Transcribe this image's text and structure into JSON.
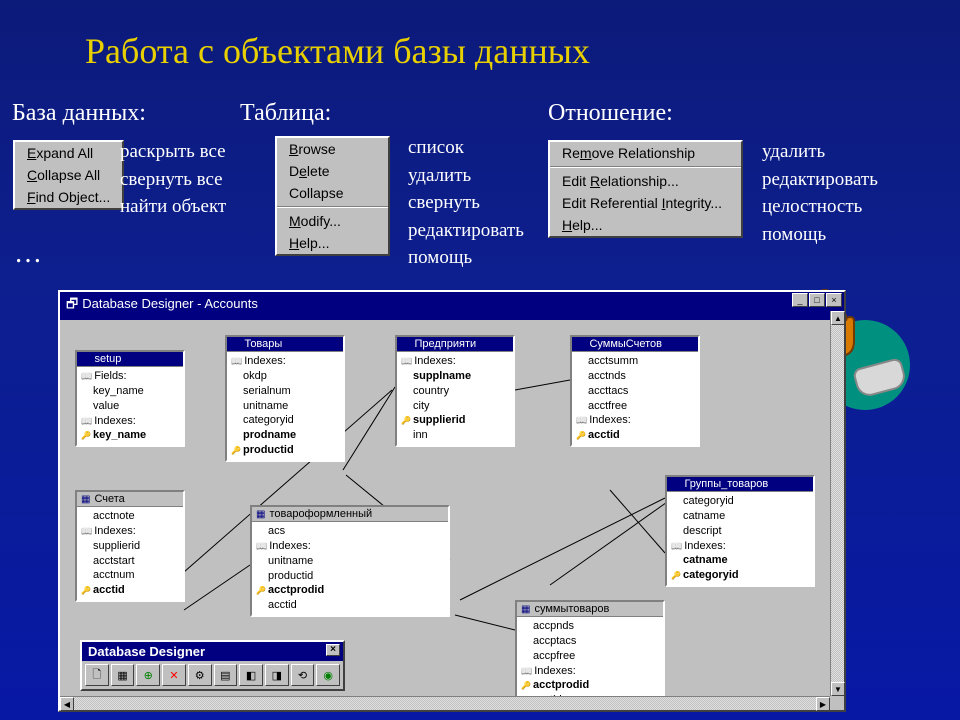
{
  "title": "Работа с объектами базы данных",
  "sections": {
    "db": "База данных:",
    "table": "Таблица:",
    "rel": "Отношение:"
  },
  "ellipsis": "…",
  "menu_db": {
    "expand": "Expand All",
    "collapse": "Collapse All",
    "find": "Find Object..."
  },
  "ru_db": {
    "expand": "раскрыть все",
    "collapse": "свернуть все",
    "find": "найти объект"
  },
  "menu_table": {
    "browse": "Browse",
    "delete": "Delete",
    "collapse": "Collapse",
    "modify": "Modify...",
    "help": "Help..."
  },
  "ru_table": {
    "browse": "список",
    "delete": "удалить",
    "collapse": "свернуть",
    "modify": "редактировать",
    "help": "помощь"
  },
  "menu_rel": {
    "remove": "Remove Relationship",
    "edit": "Edit Relationship...",
    "integrity": "Edit Referential Integrity...",
    "help": "Help..."
  },
  "ru_rel": {
    "remove": "удалить",
    "edit": "редактировать",
    "integrity": "целостность",
    "help": "помощь"
  },
  "designer_title": "Database Designer - Accounts",
  "toolbar_title": "Database Designer",
  "tables": {
    "setup": {
      "title": "setup",
      "fields": "Fields:",
      "f1": "key_name",
      "f2": "value",
      "idx": "Indexes:",
      "k": "key_name"
    },
    "tovary": {
      "title": "Товары",
      "idx": "Indexes:",
      "f1": "okdp",
      "f2": "serialnum",
      "f3": "unitname",
      "f4": "categoryid",
      "f5": "prodname",
      "k": "productid"
    },
    "pred": {
      "title": "Предприяти",
      "idx": "Indexes:",
      "f1": "supplname",
      "f2": "country",
      "f3": "city",
      "k": "supplierid",
      "f4": "inn"
    },
    "summy": {
      "title": "СуммыСчетов",
      "f1": "acctsumm",
      "f2": "acctnds",
      "f3": "accttacs",
      "f4": "acctfree",
      "idx": "Indexes:",
      "k": "acctid"
    },
    "scheta": {
      "title": "Счета",
      "f1": "acctnote",
      "idx": "Indexes:",
      "f2": "supplierid",
      "f3": "acctstart",
      "f4": "acctnum",
      "k": "acctid"
    },
    "tovof": {
      "title": "товароформленный",
      "f1": "acs",
      "idx": "Indexes:",
      "f2": "unitname",
      "f3": "productid",
      "k": "acctprodid",
      "f4": "acctid"
    },
    "gruppy": {
      "title": "Группы_товаров",
      "f1": "categoryid",
      "f2": "catname",
      "f3": "descript",
      "idx": "Indexes:",
      "f4": "catname",
      "k": "categoryid"
    },
    "summytov": {
      "title": "суммытоваров",
      "f1": "accpnds",
      "f2": "accptacs",
      "f3": "accpfree",
      "idx": "Indexes:",
      "k": "acctprodid",
      "f4": "acctid"
    }
  }
}
